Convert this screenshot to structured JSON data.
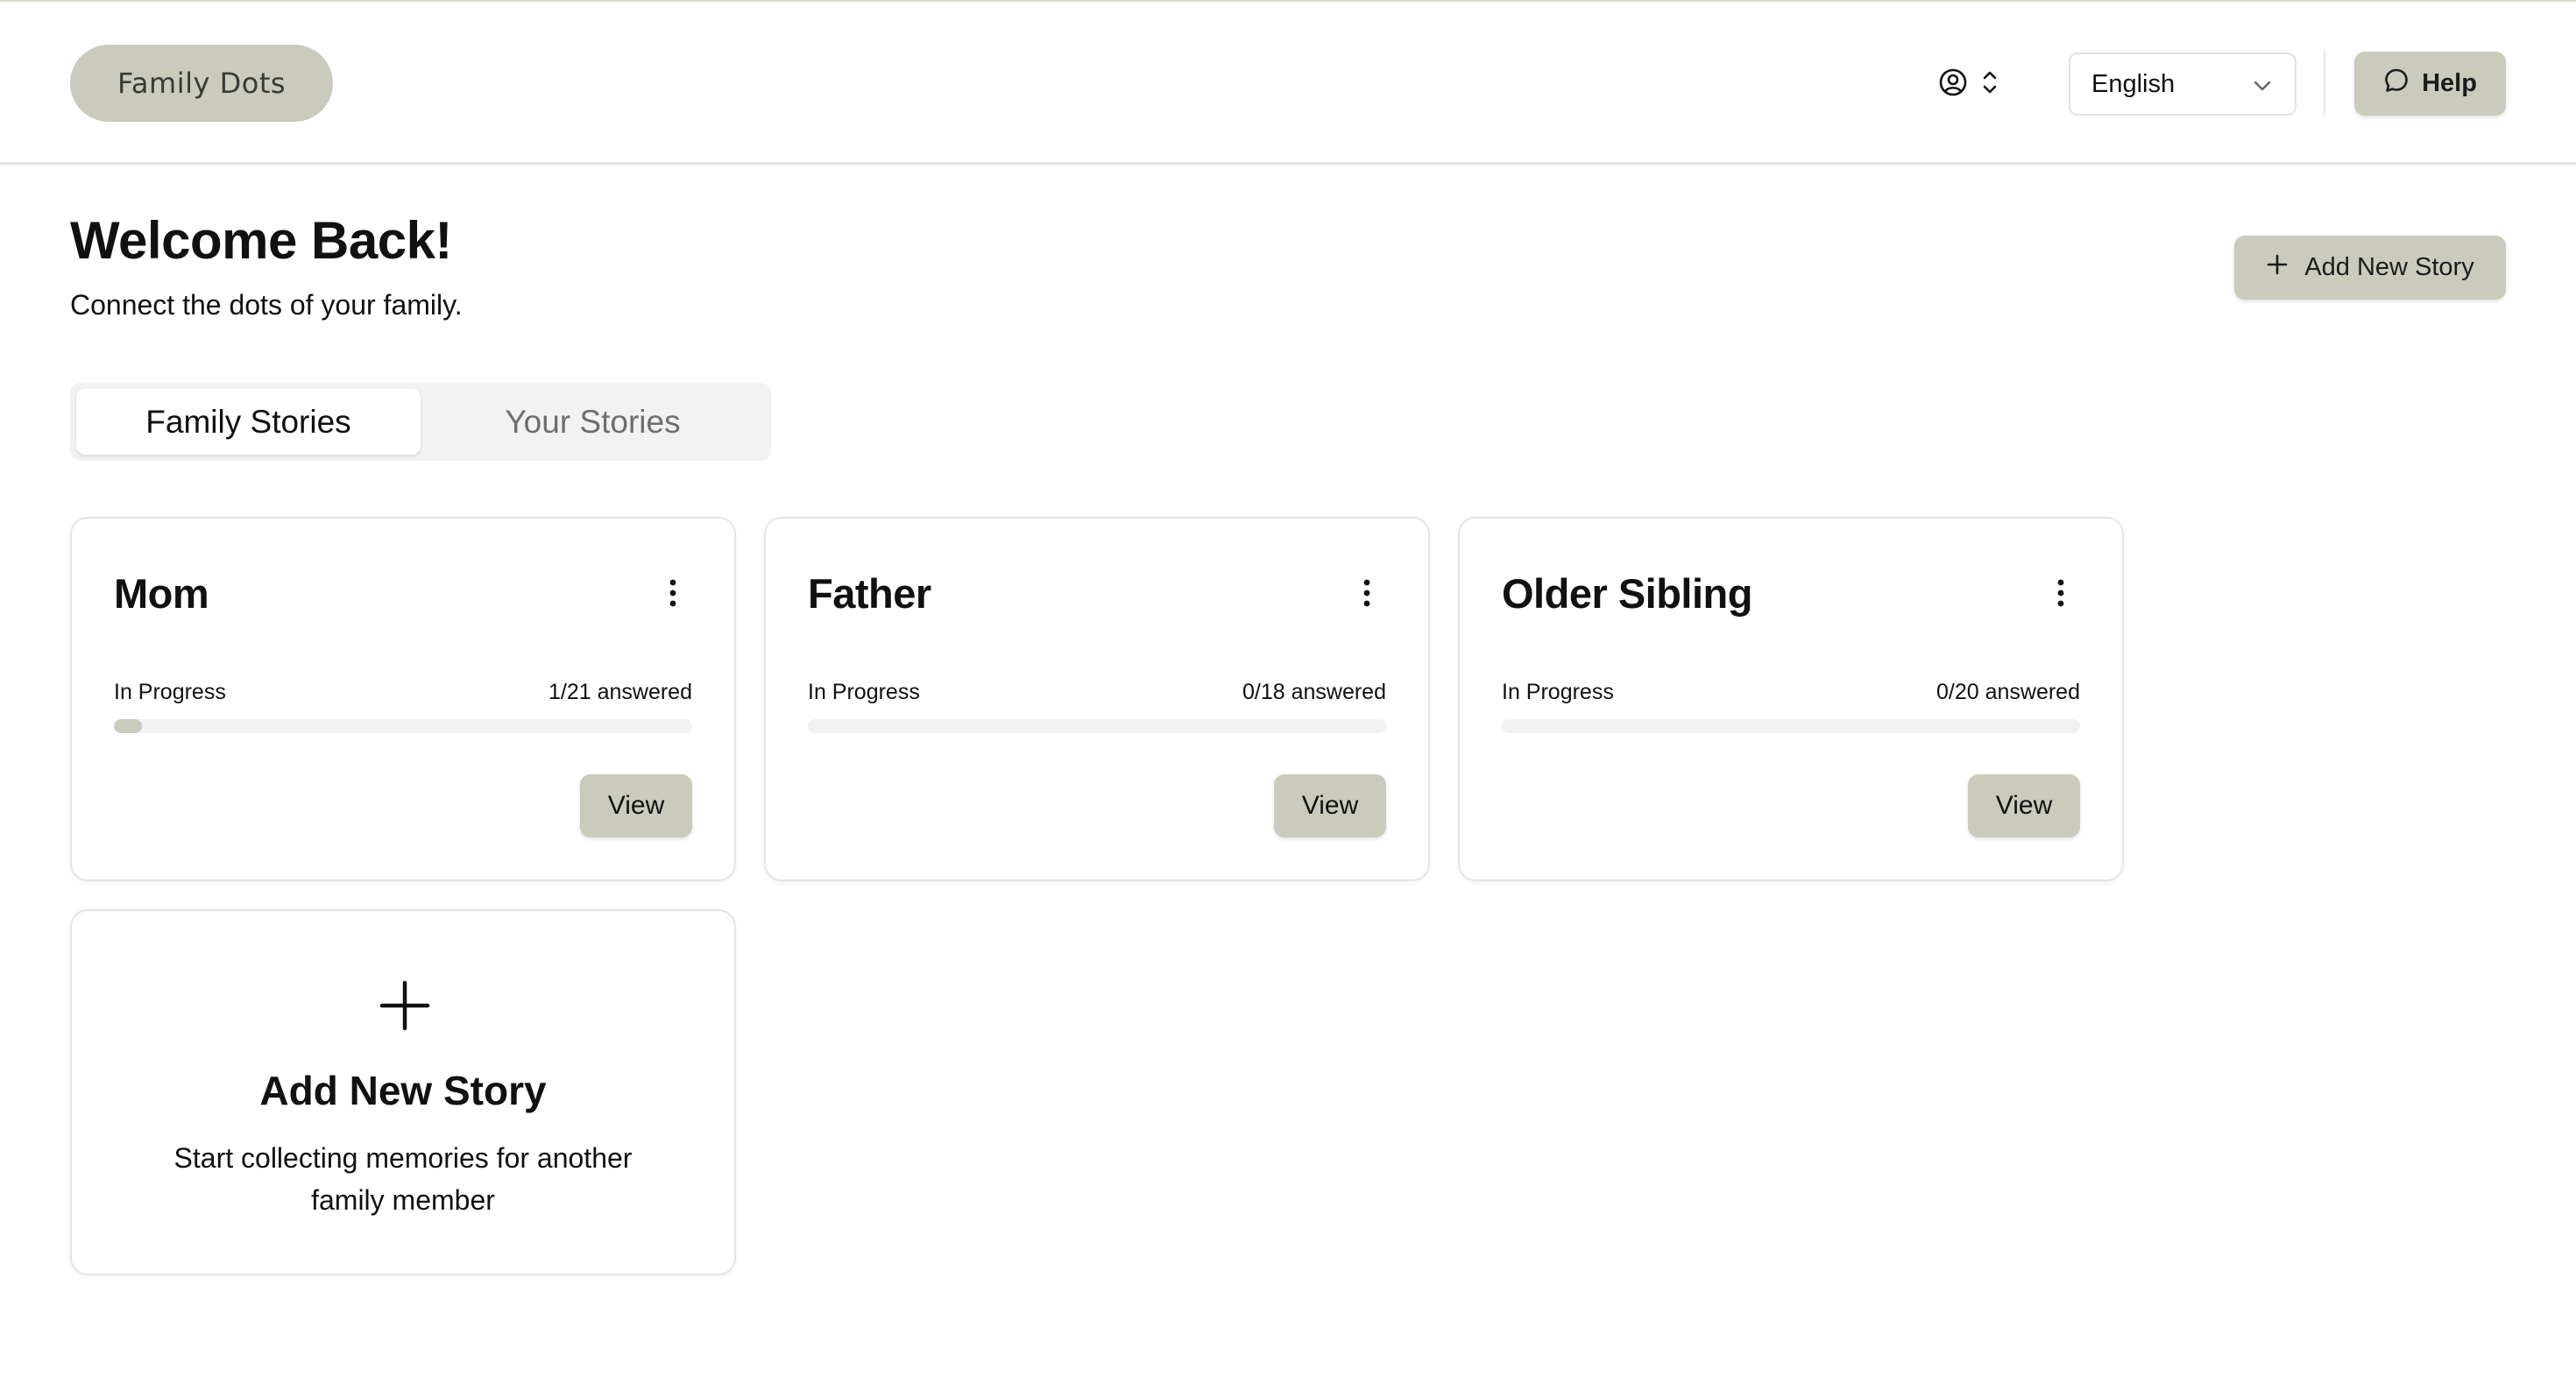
{
  "header": {
    "logo": "Family Dots",
    "language": "English",
    "help_label": "Help"
  },
  "main": {
    "title": "Welcome Back!",
    "subtitle": "Connect the dots of your family.",
    "add_story_label": "Add New Story",
    "tabs": [
      {
        "label": "Family Stories",
        "active": true
      },
      {
        "label": "Your Stories",
        "active": false
      }
    ]
  },
  "stories": [
    {
      "name": "Mom",
      "status": "In Progress",
      "answered": "1/21 answered",
      "progress": 0.048,
      "view_label": "View"
    },
    {
      "name": "Father",
      "status": "In Progress",
      "answered": "0/18 answered",
      "progress": 0,
      "view_label": "View"
    },
    {
      "name": "Older Sibling",
      "status": "In Progress",
      "answered": "0/20 answered",
      "progress": 0,
      "view_label": "View"
    }
  ],
  "add_card": {
    "title": "Add New Story",
    "description": "Start collecting memories for another family member"
  },
  "colors": {
    "accent": "#cbcbbd",
    "track": "#f2f2f2",
    "text": "#111111"
  }
}
